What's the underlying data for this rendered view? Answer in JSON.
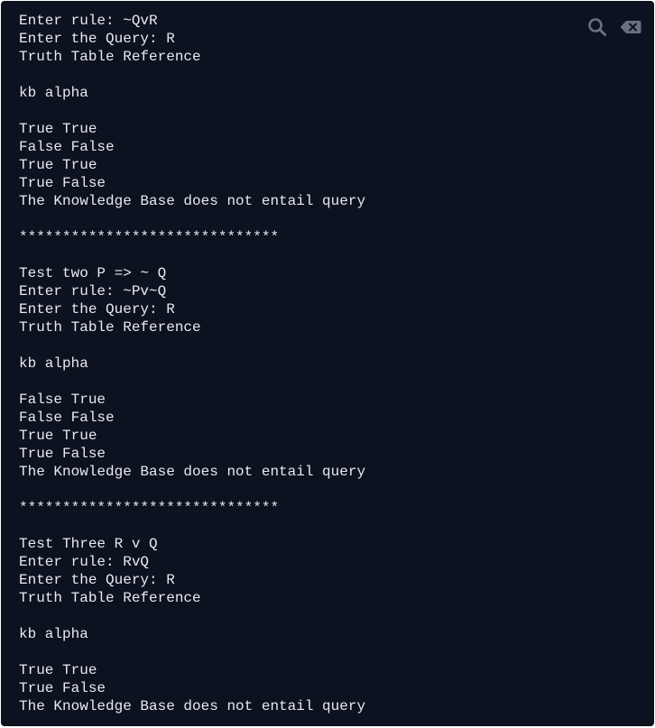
{
  "toolbar": {
    "search_icon": "search-icon",
    "clear_icon": "clear-icon",
    "icon_color": "#6b7080"
  },
  "output": {
    "lines": [
      "Enter rule: ~QvR",
      "Enter the Query: R",
      "Truth Table Reference",
      "",
      "kb alpha",
      "",
      "True True",
      "False False",
      "True True",
      "True False",
      "The Knowledge Base does not entail query",
      "",
      "******************************",
      "",
      "Test two P => ~ Q",
      "Enter rule: ~Pv~Q",
      "Enter the Query: R",
      "Truth Table Reference",
      "",
      "kb alpha",
      "",
      "False True",
      "False False",
      "True True",
      "True False",
      "The Knowledge Base does not entail query",
      "",
      "******************************",
      "",
      "Test Three R v Q",
      "Enter rule: RvQ",
      "Enter the Query: R",
      "Truth Table Reference",
      "",
      "kb alpha",
      "",
      "True True",
      "True False",
      "The Knowledge Base does not entail query"
    ]
  }
}
